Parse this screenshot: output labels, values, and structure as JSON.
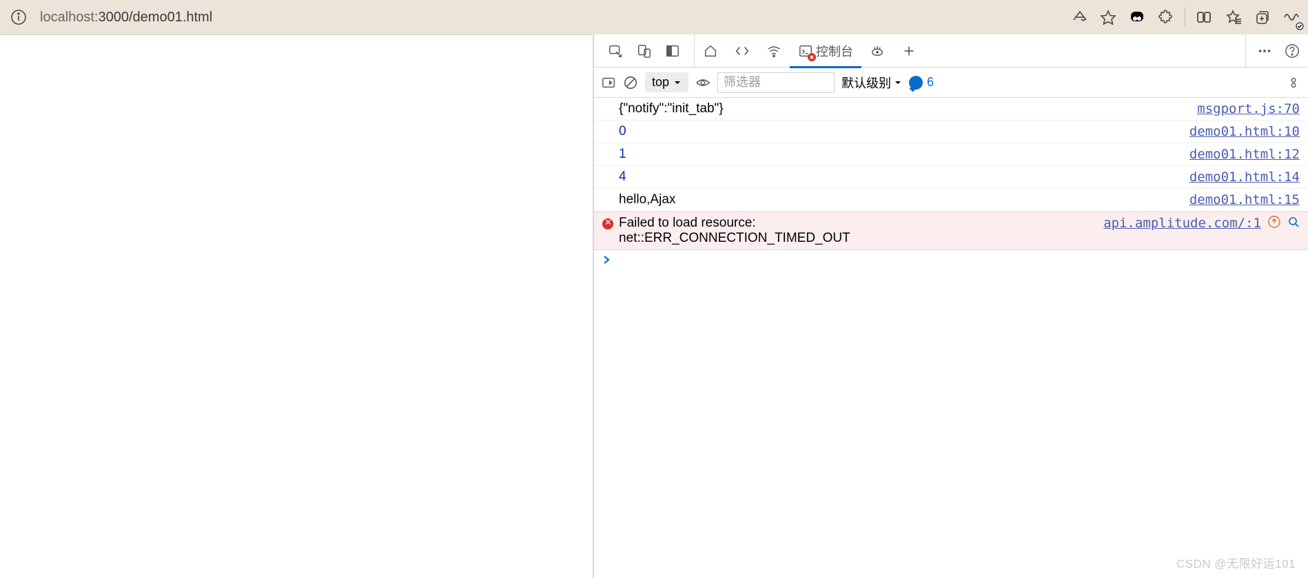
{
  "addr": {
    "host": "localhost:",
    "rest": "3000/demo01.html"
  },
  "devtools": {
    "console_tab_label": "控制台",
    "toolbar": {
      "context": "top",
      "filter_placeholder": "筛选器",
      "level_label": "默认级别",
      "msg_count": "6"
    },
    "rows": [
      {
        "msg": "{\"notify\":\"init_tab\"}",
        "src": "msgport.js:70",
        "kind": "log"
      },
      {
        "msg": "0",
        "src": "demo01.html:10",
        "kind": "num"
      },
      {
        "msg": "1",
        "src": "demo01.html:12",
        "kind": "num"
      },
      {
        "msg": "4",
        "src": "demo01.html:14",
        "kind": "num"
      },
      {
        "msg": "hello,Ajax",
        "src": "demo01.html:15",
        "kind": "log"
      },
      {
        "msg": "Failed to load resource:\nnet::ERR_CONNECTION_TIMED_OUT",
        "src": "api.amplitude.com/:1",
        "kind": "err"
      }
    ]
  },
  "watermark": "CSDN @无限好运101"
}
